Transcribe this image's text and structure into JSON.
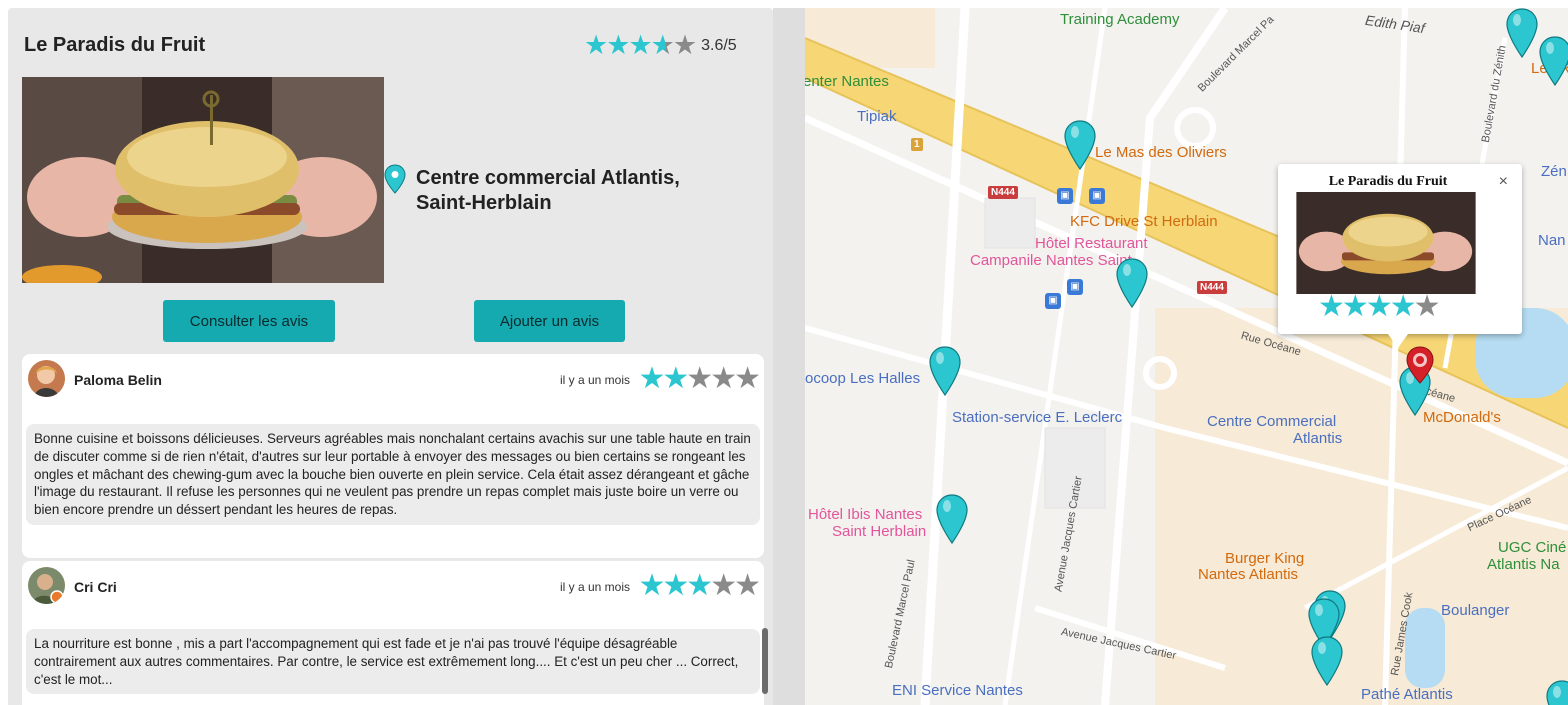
{
  "restaurant": {
    "name": "Le Paradis du Fruit",
    "rating_text": "3.6/5",
    "address_line1": "Centre commercial Atlantis,",
    "address_line2": "Saint-Herblain"
  },
  "buttons": {
    "consult": "Consulter les avis",
    "add": "Ajouter un avis"
  },
  "reviews": [
    {
      "author": "Paloma Belin",
      "time": "il y a un mois",
      "stars": 2,
      "text": "Bonne cuisine et boissons délicieuses. Serveurs agréables mais nonchalant certains avachis sur une table haute en train de discuter comme si de rien n'était, d'autres sur leur portable à envoyer des messages ou bien certains se rongeant les ongles et mâchant des chewing-gum avec la bouche bien ouverte en plein service. Cela était assez dérangeant et gâche l'image du restaurant. Il refuse les personnes qui ne veulent pas prendre un repas complet mais juste boire un verre ou bien encore prendre un déssert pendant les heures de repas."
    },
    {
      "author": "Cri Cri",
      "time": "il y a un mois",
      "stars": 3,
      "text": "La nourriture est bonne , mis a part l'accompagnement qui est fade et je n'ai pas trouvé l'équipe désagréable contrairement aux autres commentaires. Par contre, le service est extrêmement long.... Et c'est un peu cher ... Correct, c'est le mot..."
    }
  ],
  "rating_value": 3.6,
  "colors": {
    "accent": "#15a9b0",
    "star_on": "#2bc6cf",
    "star_off": "#8a8a8a",
    "panel_bg": "#e8e8e8"
  },
  "map": {
    "pois": {
      "training": "Training Academy",
      "edith": "Edith Piaf",
      "center": "enter Nantes",
      "tipiak": "Tipiak",
      "mas": "Le Mas des Oliviers",
      "kfc": "KFC Drive St Herblain",
      "hotel1": "Hôtel Restaurant",
      "hotel2": "Campanile Nantes Saint...",
      "coop": "ocoop Les Halles",
      "station": "Station-service E. Leclerc",
      "ccatl1": "Centre Commercial",
      "ccatl2": "Atlantis",
      "mcdo": "McDonald's",
      "ibis1": "Hôtel Ibis Nantes",
      "ibis2": "Saint Herblain",
      "bk1": "Burger King",
      "bk2": "Nantes Atlantis",
      "ugc1": "UGC Ciné",
      "ugc2": "Atlantis Na",
      "boulanger": "Boulanger",
      "eni": "ENI Service Nantes",
      "pathe": "Pathé Atlantis",
      "lesr": "Les R",
      "zen": "Zén",
      "nan": "Nan"
    },
    "streets": {
      "marcelpaul": "Boulevard Marcel Paul",
      "marcelpaul_top": "Boulevard Marcel Pa",
      "jacques": "Avenue Jacques Cartier",
      "jacques2": "Avenue Jacques Cartier",
      "oceane": "Rue Océane",
      "oceane2": "Océane",
      "place": "Place Océane",
      "zenith": "Boulevard du Zénith",
      "cook": "Rue James Cook"
    },
    "roads": {
      "n444a": "N444",
      "n444b": "N444",
      "one": "1"
    },
    "infowindow": {
      "title": "Le Paradis du Fruit",
      "close": "×",
      "stars": 4
    }
  }
}
